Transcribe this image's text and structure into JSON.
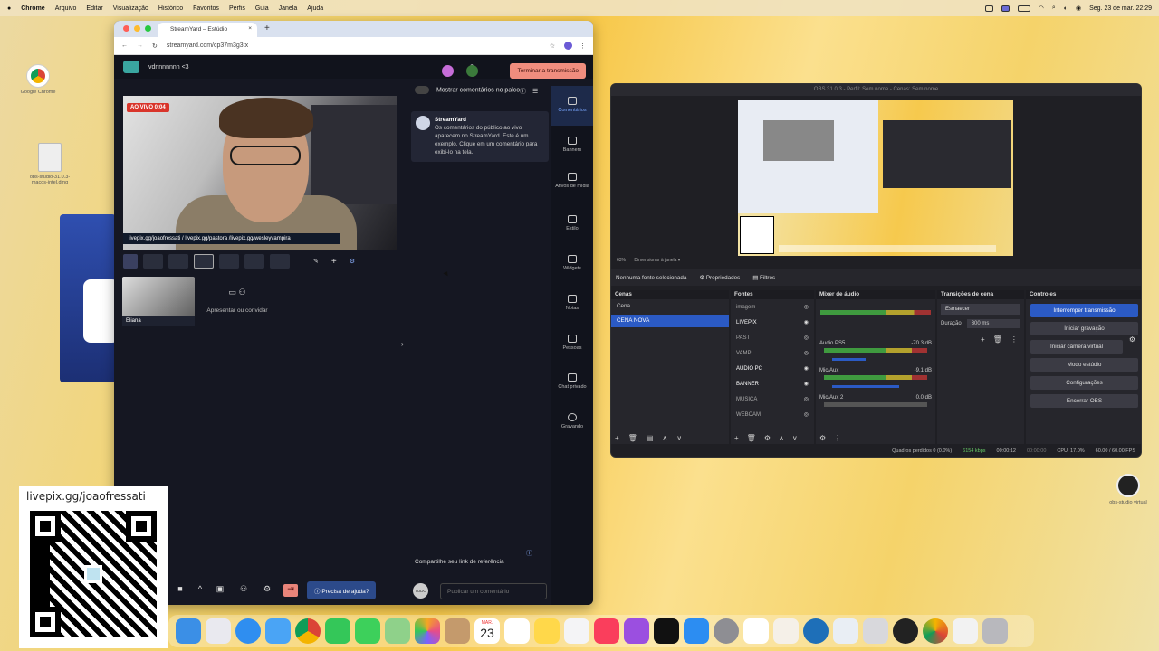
{
  "menubar": {
    "apple": "",
    "app": "Chrome",
    "items": [
      "Arquivo",
      "Editar",
      "Visualização",
      "Histórico",
      "Favoritos",
      "Perfis",
      "Guia",
      "Janela",
      "Ajuda"
    ],
    "datetime": "Seg. 23 de mar.  22:29"
  },
  "desktop": {
    "chrome_label": "Google Chrome",
    "dmg_label": "obs-studio-31.0.3-macos-intel.dmg",
    "obs_label": "obs-studio virtual"
  },
  "browser": {
    "tab_title": "StreamYard – Estúdio",
    "url": "streamyard.com/cp37m3g3tx"
  },
  "streamyard": {
    "broadcast_name": "vdnnnnnnn <3",
    "end_button": "Terminar a transmissão",
    "live_badge": "AO VIVO 0:04",
    "banner_text": "livepix.gg/joaofressati / livepix.gg/pastora /livepix.gg/wesleyvampira",
    "participant_name": "Eliana",
    "present_invite": "Apresentar ou convidar",
    "help_button": "Precisa de ajuda?",
    "comments": {
      "show_on_stage": "Mostrar comentários no palco",
      "card_author": "StreamYard",
      "card_text": "Os comentários do público ao vivo aparecem no StreamYard. Este é um exemplo. Clique em um comentário para exibi-lo na tela.",
      "share_link": "Compartilhe seu link de referência",
      "audience_badge": "TUDO",
      "comment_placeholder": "Publicar um comentário"
    },
    "nav": [
      {
        "label": "Comentários",
        "icon": "comment-icon"
      },
      {
        "label": "Banners",
        "icon": "banner-icon"
      },
      {
        "label": "Ativos de mídia",
        "icon": "media-icon"
      },
      {
        "label": "Estilo",
        "icon": "palette-icon"
      },
      {
        "label": "Widgets",
        "icon": "widgets-icon"
      },
      {
        "label": "Notas",
        "icon": "notes-icon"
      },
      {
        "label": "Pessoas",
        "icon": "people-icon"
      },
      {
        "label": "Chat privado",
        "icon": "chat-icon"
      },
      {
        "label": "Gravando",
        "icon": "record-icon"
      }
    ]
  },
  "qr_overlay": {
    "text": "livepix.gg/joaofressati"
  },
  "obs": {
    "title": "OBS 31.0.3 - Perfil: Sem nome - Cenas: Sem nome",
    "zoom": "63%",
    "resize_mode": "Dimensionar à janela",
    "no_source": "Nenhuma fonte selecionada",
    "properties": "Propriedades",
    "filters": "Filtros",
    "docks": {
      "scenes": "Cenas",
      "sources": "Fontes",
      "mixer": "Mixer de áudio",
      "transitions": "Transições de cena",
      "controls": "Controles"
    },
    "scenes": [
      "Cena",
      "CENA NOVA"
    ],
    "sources": [
      "imagem",
      "LIVEPIX",
      "PAST",
      "VAMP",
      "AUDIO PC",
      "BANNER",
      "MUSICA",
      "WEBCAM"
    ],
    "mixer": [
      {
        "name": "Audio PS5",
        "db": "-70.3 dB"
      },
      {
        "name": "Mic/Aux",
        "db": "-9.1 dB"
      },
      {
        "name": "Mic/Aux 2",
        "db": "0.0 dB"
      }
    ],
    "transition": "Esmaecer",
    "duration_label": "Duração",
    "duration_value": "300 ms",
    "controls": [
      "Interromper transmissão",
      "Iniciar gravação",
      "Iniciar câmera virtual",
      "Modo estúdio",
      "Configurações",
      "Encerrar OBS"
    ],
    "status": {
      "dropped": "Quadros perdidos 0 (0.0%)",
      "bitrate": "6154 kbps",
      "live_time": "00:00:12",
      "rec_time": "00:00:00",
      "cpu": "CPU: 17.0%",
      "fps": "60.00 / 60.00 FPS"
    }
  },
  "dock_apps": [
    "finder",
    "launchpad",
    "safari",
    "mail",
    "chrome",
    "facetime",
    "messages",
    "maps",
    "photos",
    "contacts",
    "calendar",
    "reminders",
    "notes",
    "freeform",
    "music",
    "podcasts",
    "tv",
    "appstore",
    "settings",
    "capcut",
    "stickies",
    "quicktime",
    "preview",
    "scripteditor",
    "obs",
    "chrome-canary",
    "documents",
    "trash"
  ],
  "calendar_day": "23",
  "calendar_month": "MAR."
}
